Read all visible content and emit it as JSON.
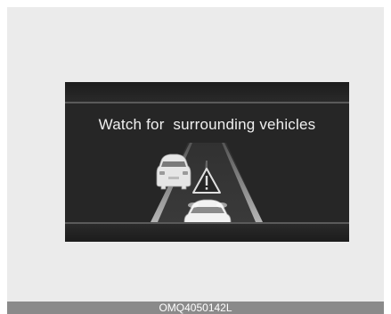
{
  "display": {
    "message": "Watch for  surrounding vehicles"
  },
  "figure": {
    "code": "OMQ4050142L"
  },
  "icons": {
    "warning": "warning-triangle-icon",
    "side_vehicle": "car-rear-icon",
    "own_vehicle": "car-rear-icon"
  },
  "colors": {
    "screen_background": "#262626",
    "text": "#f0f0f0",
    "caption_bar": "#8a8a8a"
  }
}
